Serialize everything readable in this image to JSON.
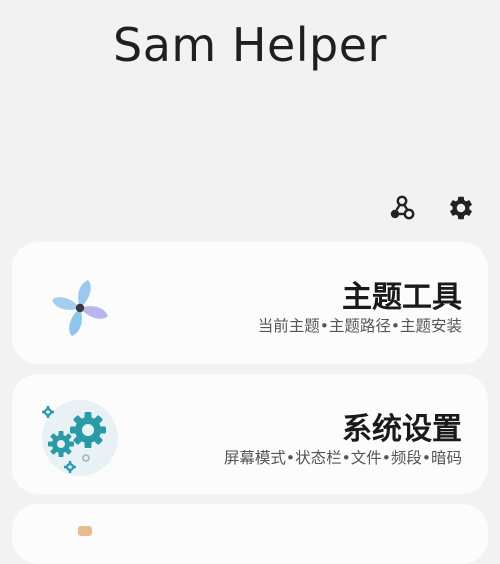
{
  "app": {
    "title": "Sam Helper"
  },
  "toolbar": {
    "left_icon": "molecule-icon",
    "right_icon": "gear-icon"
  },
  "cards": [
    {
      "title": "主题工具",
      "subtitle": "当前主题•主题路径•主题安装",
      "icon": "pinwheel-icon"
    },
    {
      "title": "系统设置",
      "subtitle": "屏幕模式•状态栏•文件•频段•暗码",
      "icon": "gears-icon"
    }
  ],
  "colors": {
    "background": "#f2f2f2",
    "card": "#fcfcfc",
    "gear_teal": "#2a9aa6",
    "pinwheel_blue": "#8cc8ec",
    "pinwheel_purple": "#b8b4ec"
  }
}
